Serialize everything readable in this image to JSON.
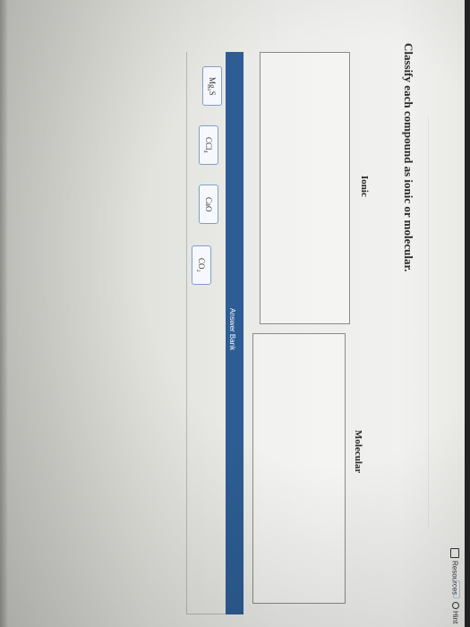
{
  "header": {
    "resources_label": "Resources",
    "hint_label": "Hint"
  },
  "question": {
    "prompt": "Classify each compound as ionic or molecular."
  },
  "categories": [
    {
      "label": "Ionic"
    },
    {
      "label": "Molecular"
    }
  ],
  "answer_bank": {
    "label": "Answer Bank",
    "items": [
      {
        "label": "Mg₂S"
      },
      {
        "label": "CCl₄"
      },
      {
        "label": "CaO"
      },
      {
        "label": "CO₂"
      }
    ]
  },
  "icons": {
    "resources": "document-icon",
    "hint": "lightbulb-icon"
  },
  "colors": {
    "answer_bank_bar": "#2d5d94",
    "chip_border": "#7fa0c8"
  }
}
